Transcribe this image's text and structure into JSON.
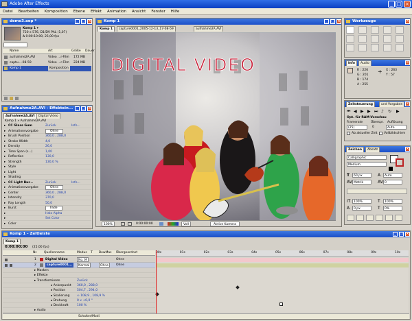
{
  "app": {
    "title": "Adobe After Effects"
  },
  "menu": [
    "Datei",
    "Bearbeiten",
    "Komposition",
    "Ebene",
    "Effekt",
    "Animation",
    "Ansicht",
    "Fenster",
    "Hilfe"
  ],
  "project": {
    "title": "demo3.aep *",
    "comp_name": "Komp 1 ▾",
    "info1": "720 x 576, D1/DV PAL (1,07)",
    "info2": "Δ 0:00:10:00, 25,00 fps",
    "columns": [
      "Name",
      "Art",
      "Größe",
      "Dauer"
    ],
    "items": [
      {
        "name": "aufnahme2A.AVI",
        "type": "Video ...r-Film",
        "size": "172 MB"
      },
      {
        "name": "captu...-08-59",
        "type": "Video ...r-Film",
        "size": "224 MB"
      },
      {
        "name": "Komp 1",
        "type": "Komposition",
        "size": ""
      }
    ]
  },
  "effects": {
    "title": "Aufnahme2A.AVI - Effektein...",
    "tabs": [
      "Aufnahme2A.AVI",
      "Digital Video"
    ],
    "path": "Komp 1 » Aufnahme2A.AVI",
    "rows": [
      {
        "label": "CC Glass Gum",
        "value": "Zurück",
        "extra": "Info..."
      },
      {
        "label": "Animationsvorgabe",
        "value": "Ohne",
        "extra": ""
      },
      {
        "label": "Brush Position",
        "value": "360,0 , 288,0",
        "extra": ""
      },
      {
        "label": "Stroke Width",
        "value": "4,0",
        "extra": ""
      },
      {
        "label": "Density",
        "value": "26,0",
        "extra": ""
      },
      {
        "label": "Time Span (s...)",
        "value": "1,00",
        "extra": ""
      },
      {
        "label": "Reflection",
        "value": "130,0",
        "extra": ""
      },
      {
        "label": "Strength",
        "value": "130,0 %",
        "extra": ""
      },
      {
        "label": "Style",
        "value": "",
        "extra": ""
      },
      {
        "label": "Light",
        "value": "",
        "extra": ""
      },
      {
        "label": "Shading",
        "value": "",
        "extra": ""
      },
      {
        "label": "CC Light Bur...",
        "value": "Zurück",
        "extra": "Info..."
      },
      {
        "label": "Animationsvorgabe",
        "value": "Ohne",
        "extra": ""
      },
      {
        "label": "Center",
        "value": "360,0 , 288,0",
        "extra": ""
      },
      {
        "label": "Intensity",
        "value": "370,0",
        "extra": ""
      },
      {
        "label": "Ray Length",
        "value": "50,0",
        "extra": ""
      },
      {
        "label": "Burst",
        "value": "Fade",
        "extra": ""
      },
      {
        "label": "",
        "value": "Halo Alpha",
        "extra": ""
      },
      {
        "label": "",
        "value": "Set Color",
        "extra": ""
      },
      {
        "label": "Color",
        "value": "",
        "extra": ""
      }
    ]
  },
  "comp": {
    "title": "Komp 1",
    "tabs": [
      "Komp 1",
      "capture0001_2005-12-13_17-08-59",
      "aufnahme2A.AVI"
    ],
    "overlay_text": "DIGITAL VIDEO",
    "footer": [
      "100%",
      "0:00:00:00",
      "Voll",
      "Aktive Kamera"
    ]
  },
  "tools": {
    "title": "Werkzeuge"
  },
  "info": {
    "tabs": [
      "Info",
      "Audio"
    ],
    "r": "R : 226",
    "g": "G : 201",
    "b": "B : 174",
    "a": "A : 255",
    "x": "X : 263",
    "y": "Y : 57"
  },
  "preview": {
    "title": "Zeitsteuerung",
    "tab2": "und Vorgaben",
    "opt": "Opt. für RAM-Vorschau",
    "labels": [
      "Framerate",
      "Überspr.",
      "Auflösung"
    ],
    "values": [
      "(25)",
      "0",
      "Auto"
    ],
    "checks": [
      "Ab aktueller Zeit",
      "Vollbildschirm"
    ]
  },
  "char": {
    "tabs": [
      "Zeichen",
      "Absatz"
    ],
    "font": "Calligraphic",
    "style": "Medium",
    "size": "60 px",
    "leading": "Auto",
    "kern": "Metrik",
    "track": "0",
    "vscale": "100%",
    "hscale": "100%",
    "baseline": "0 px",
    "tsume": "0%"
  },
  "timeline": {
    "title": "Komp 1 - Zeitleiste",
    "tab": "Komp 1",
    "time": "0:00:00:00",
    "fps": "(25.00 fps)",
    "cols": [
      "Nr.",
      "Quellenname",
      "Modus",
      "T",
      "BewMas",
      "Übergeordnet"
    ],
    "ruler": [
      "00s",
      "01s",
      "02s",
      "03s",
      "04s",
      "05s",
      "06s",
      "07s",
      "08s",
      "09s",
      "10s"
    ],
    "layers": [
      {
        "nr": "1",
        "name": "Digital Video",
        "mode": "No..M",
        "parent": "Ohne"
      },
      {
        "nr": "2",
        "name": "capture0001...",
        "mode": "Normal",
        "trk": "Ohne",
        "parent": "Ohne"
      }
    ],
    "props": [
      {
        "name": "Masken",
        "value": ""
      },
      {
        "name": "Effekte",
        "value": ""
      },
      {
        "name": "Transformieren",
        "value": "Zurück"
      },
      {
        "name": "Ankerpunkt",
        "value": "360,0 , 288,0"
      },
      {
        "name": "Position",
        "value": "504,7 , 294,0"
      },
      {
        "name": "Skalierung",
        "value": "∞ 108,9 , 108,9 %"
      },
      {
        "name": "Drehung",
        "value": "0 x +0,0 °"
      },
      {
        "name": "Deckkraft",
        "value": "100 %"
      },
      {
        "name": "Audio",
        "value": ""
      }
    ],
    "footer": "Schalter/Modi"
  }
}
